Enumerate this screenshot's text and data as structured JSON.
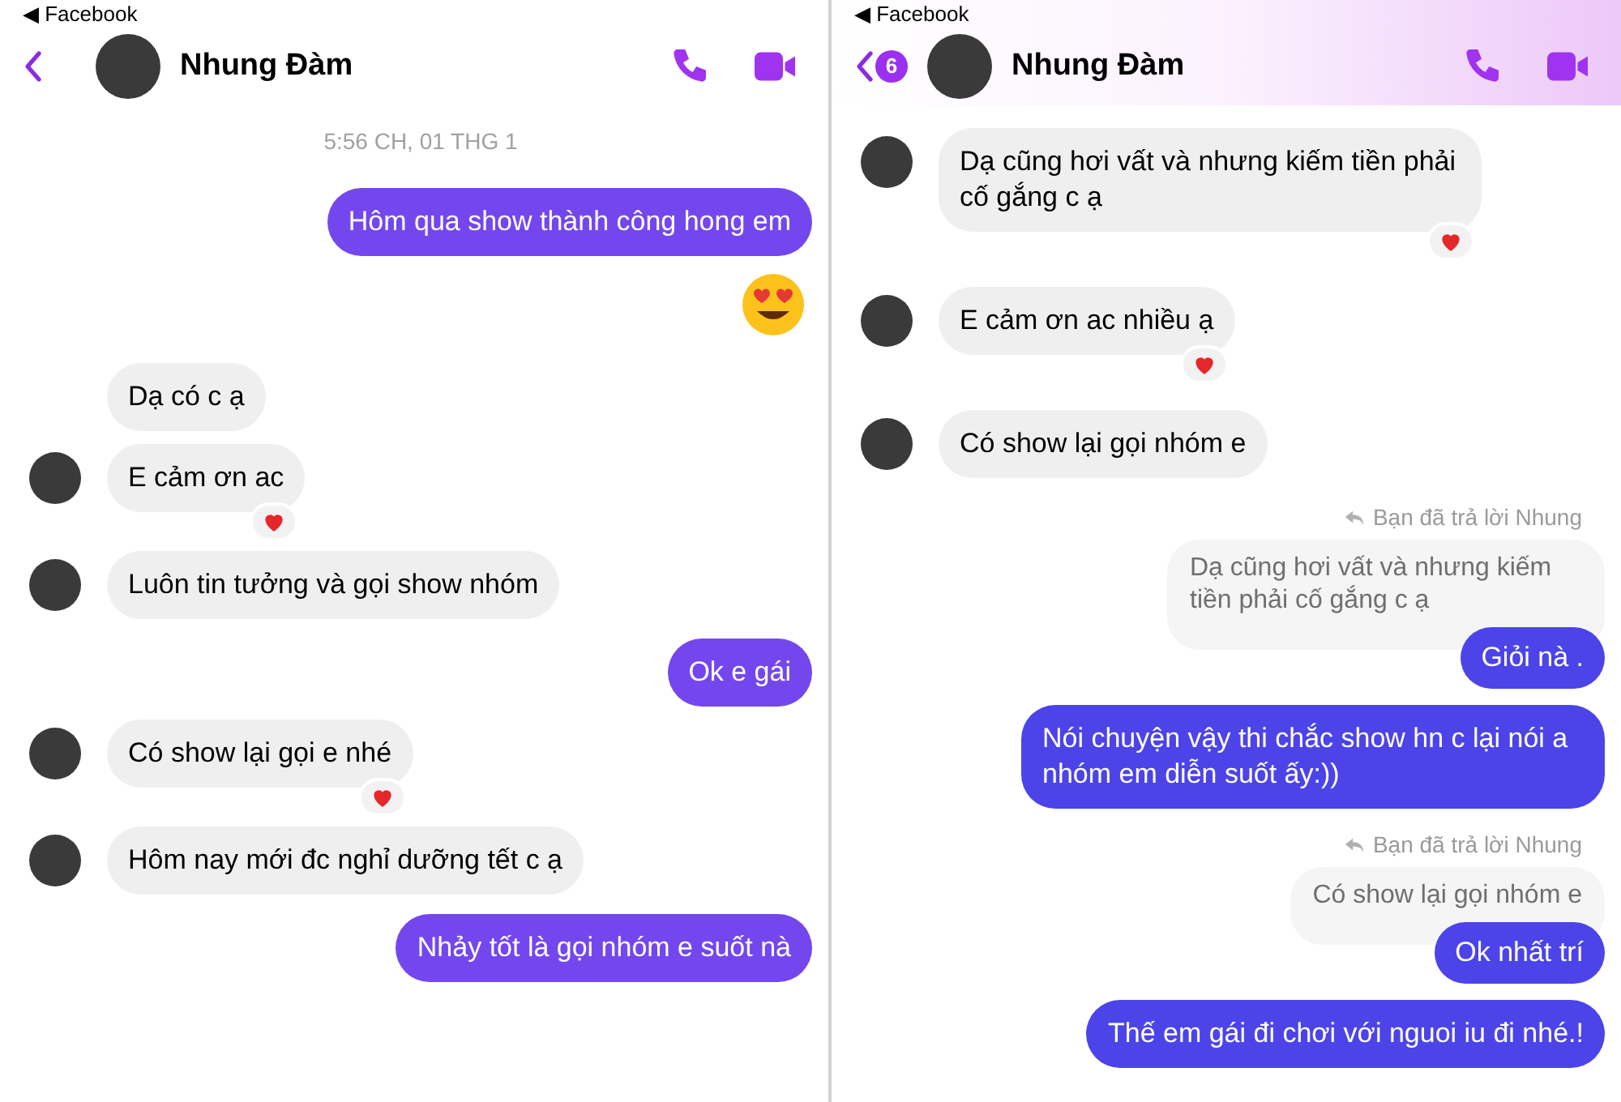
{
  "panels": [
    {
      "status_back": "◀ Facebook",
      "contact": {
        "name": "Nhung Đàm"
      },
      "messages": [
        {
          "kind": "time",
          "text": "5:56 CH, 01 THG 1"
        },
        {
          "kind": "outgoing",
          "text": "Hôm qua show thành công hong em"
        },
        {
          "kind": "emoji"
        },
        {
          "kind": "incoming",
          "text": "Dạ có c ạ",
          "avatar": false,
          "reacted": false
        },
        {
          "kind": "incoming",
          "text": "E cảm ơn ac",
          "avatar": true,
          "reacted": true
        },
        {
          "kind": "incoming",
          "text": "Luôn tin tưởng và gọi show nhóm",
          "avatar": true,
          "reacted": false
        },
        {
          "kind": "outgoing",
          "text": "Ok e gái"
        },
        {
          "kind": "incoming",
          "text": "Có show lại gọi e nhé",
          "avatar": true,
          "reacted": true
        },
        {
          "kind": "incoming",
          "text": "Hôm nay mới đc nghỉ dưỡng tết c ạ",
          "avatar": true,
          "reacted": false
        },
        {
          "kind": "outgoing",
          "text": "Nhảy tốt là gọi nhóm e suốt nà"
        }
      ]
    },
    {
      "status_back": "◀ Facebook",
      "contact": {
        "name": "Nhung Đàm",
        "badge": "6"
      },
      "messages": [
        {
          "kind": "incoming",
          "text": "Dạ cũng hơi vất và nhưng kiếm tiền phải cố gắng c ạ",
          "avatar": true,
          "reacted": true
        },
        {
          "kind": "incoming",
          "text": "E cảm ơn ac nhiều ạ",
          "avatar": true,
          "reacted": true
        },
        {
          "kind": "incoming",
          "text": "Có show lại gọi nhóm e",
          "avatar": true,
          "reacted": false
        },
        {
          "kind": "reply",
          "note": "Bạn đã trả lời Nhung",
          "quote": "Dạ cũng hơi vất và nhưng kiếm tiền phải cố gắng c ạ",
          "text": "Giỏi nà ."
        },
        {
          "kind": "outgoing",
          "text": "Nói chuyện vậy thi chắc show hn c lại nói a nhóm em diễn suốt ấy:))"
        },
        {
          "kind": "reply",
          "note": "Bạn đã trả lời Nhung",
          "quote": "Có show lại gọi nhóm e",
          "text": "Ok nhất trí"
        },
        {
          "kind": "outgoing",
          "text": "Thế em gái đi chơi với nguoi iu đi nhé.!"
        }
      ]
    }
  ]
}
